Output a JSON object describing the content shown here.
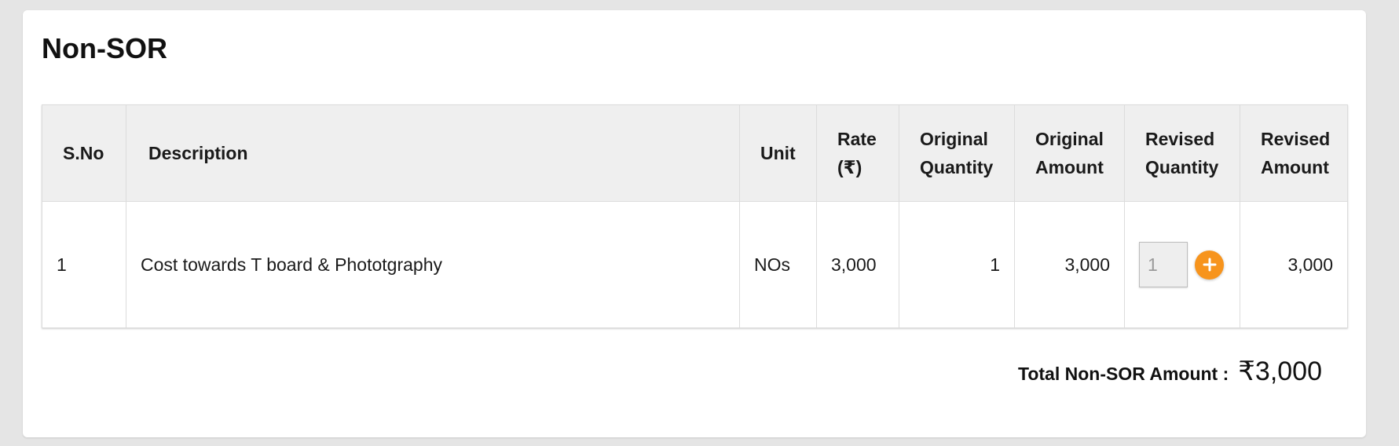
{
  "section": {
    "title": "Non-SOR"
  },
  "table": {
    "headers": {
      "sno": "S.No",
      "description": "Description",
      "unit": "Unit",
      "rate": "Rate (₹)",
      "original_quantity": "Original Quantity",
      "original_amount": "Original Amount",
      "revised_quantity": "Revised Quantity",
      "revised_amount": "Revised Amount"
    },
    "rows": [
      {
        "sno": "1",
        "description": "Cost towards T board & Photo­tgraphy",
        "unit": "NOs",
        "rate": "3,000",
        "original_quantity": "1",
        "original_amount": "3,000",
        "revised_quantity": "1",
        "revised_amount": "3,000"
      }
    ]
  },
  "summary": {
    "total_label": "Total Non-SOR Amount :",
    "total_value": "₹3,000"
  },
  "icons": {
    "add": "plus-icon"
  },
  "colors": {
    "accent": "#f7941d",
    "header_bg": "#efefef",
    "page_bg": "#e5e5e5"
  }
}
